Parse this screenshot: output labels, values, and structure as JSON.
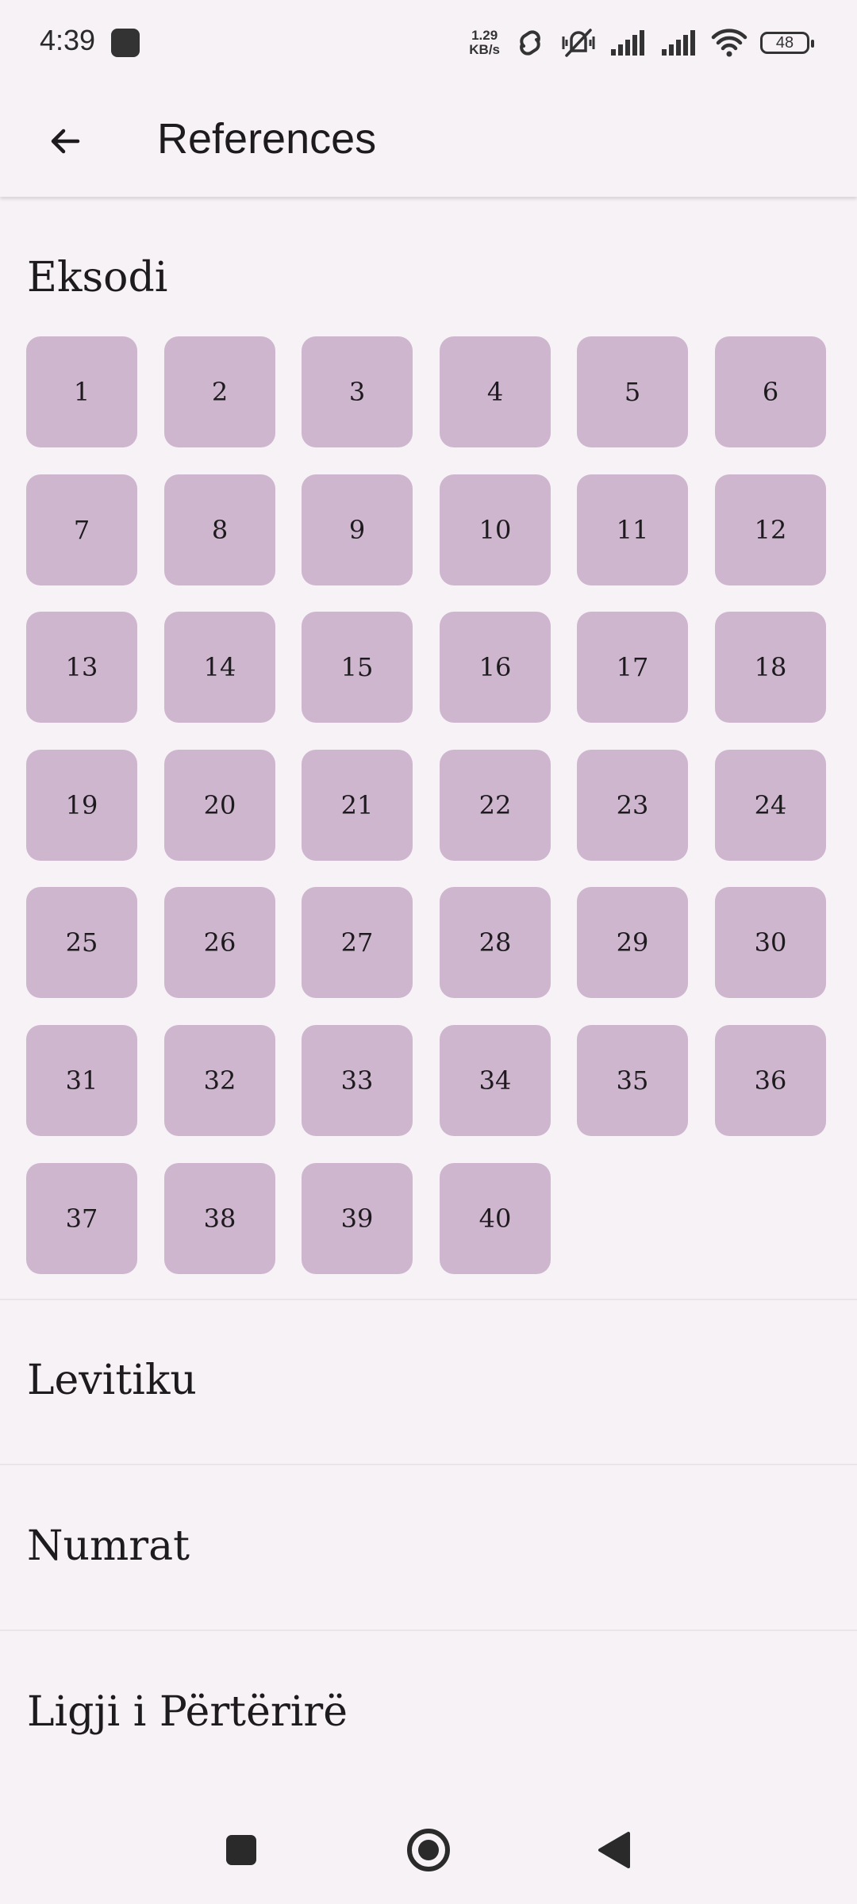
{
  "status_bar": {
    "time": "4:39",
    "net_speed_value": "1.29",
    "net_speed_unit": "KB/s",
    "battery": "48",
    "icons": [
      "app-notification-icon",
      "link-icon",
      "vibrate-off-icon",
      "signal-icon",
      "signal-icon",
      "wifi-icon",
      "battery-icon"
    ]
  },
  "app_bar": {
    "title": "References",
    "back_icon": "arrow-left-icon"
  },
  "books": [
    {
      "name": "Eksodi",
      "expanded": true,
      "chapters": [
        "1",
        "2",
        "3",
        "4",
        "5",
        "6",
        "7",
        "8",
        "9",
        "10",
        "11",
        "12",
        "13",
        "14",
        "15",
        "16",
        "17",
        "18",
        "19",
        "20",
        "21",
        "22",
        "23",
        "24",
        "25",
        "26",
        "27",
        "28",
        "29",
        "30",
        "31",
        "32",
        "33",
        "34",
        "35",
        "36",
        "37",
        "38",
        "39",
        "40"
      ]
    },
    {
      "name": "Levitiku",
      "expanded": false
    },
    {
      "name": "Numrat",
      "expanded": false
    },
    {
      "name": "Ligji i Përtërirë",
      "expanded": false
    }
  ],
  "colors": {
    "background": "#f6f2f6",
    "chapter_tile": "#cfb6cf",
    "text": "#1d1b1e"
  },
  "nav_bar": {
    "icons": [
      "recents-square-icon",
      "home-circle-icon",
      "back-triangle-icon"
    ]
  }
}
